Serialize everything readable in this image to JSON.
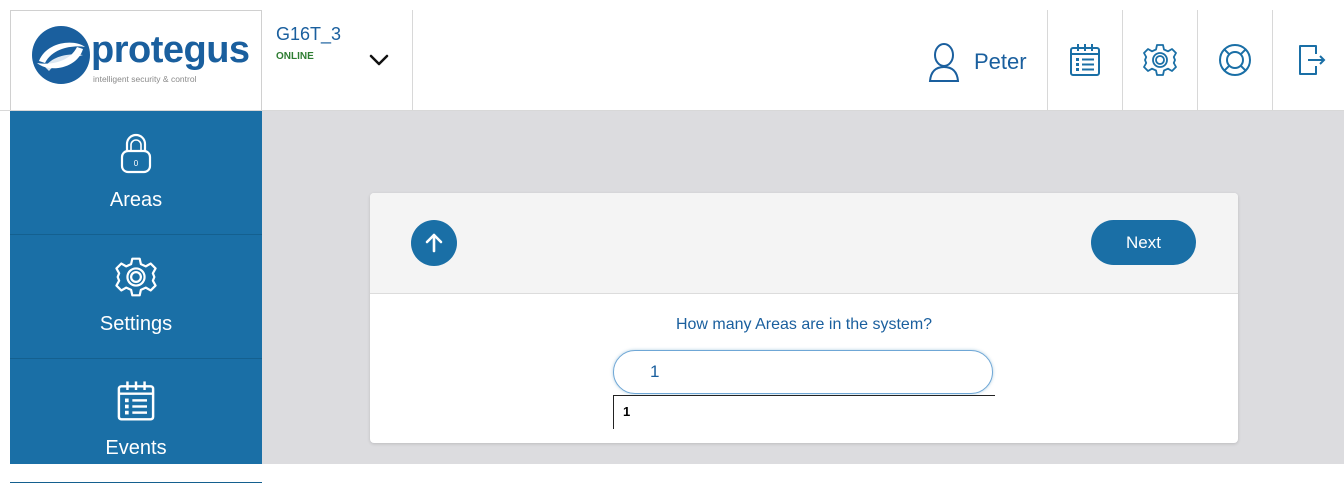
{
  "brand": {
    "name": "protegus",
    "tagline": "intelligent security & control",
    "color": "#1a5f9e"
  },
  "device": {
    "name": "G16T_3",
    "status": "ONLINE",
    "status_color": "#2e7d32"
  },
  "user": {
    "name": "Peter"
  },
  "header_actions": [
    {
      "icon": "calendar-list-icon"
    },
    {
      "icon": "gear-icon"
    },
    {
      "icon": "lifebuoy-icon"
    },
    {
      "icon": "logout-icon"
    }
  ],
  "sidebar": {
    "items": [
      {
        "label": "Areas",
        "icon": "padlock-icon"
      },
      {
        "label": "Settings",
        "icon": "gear-icon"
      },
      {
        "label": "Events",
        "icon": "calendar-list-icon"
      }
    ],
    "background": "#1a6fa6"
  },
  "wizard": {
    "next_label": "Next",
    "question": "How many Areas are in the system?",
    "answer_value": "1",
    "dropdown_options": [
      "1"
    ]
  },
  "colors": {
    "accent": "#1a6fa6",
    "content_bg": "#dcdcdf"
  }
}
